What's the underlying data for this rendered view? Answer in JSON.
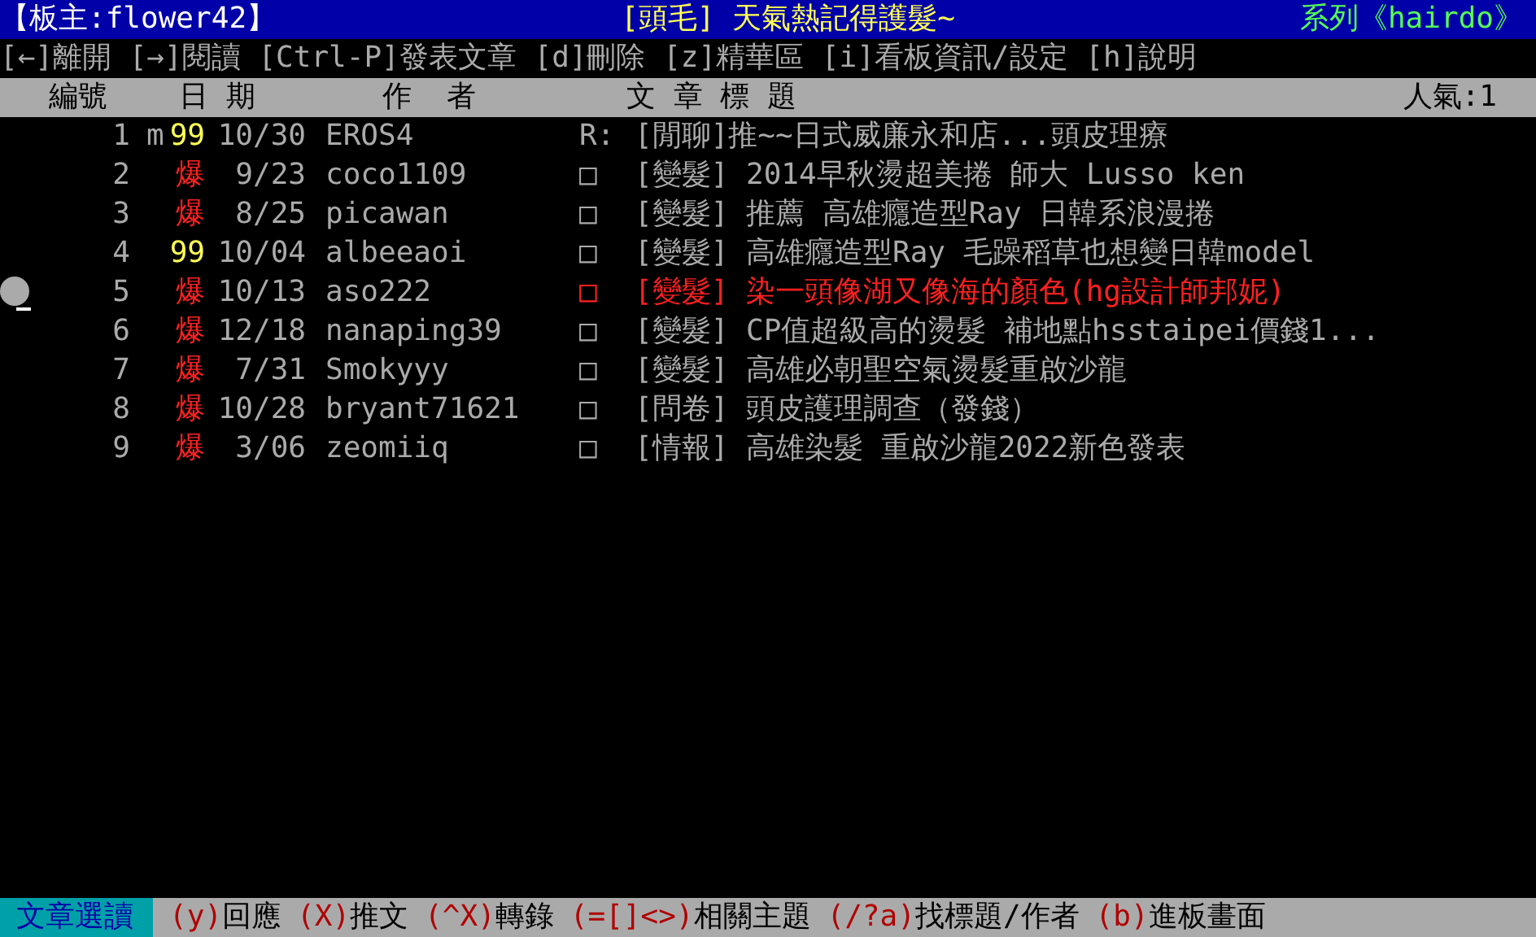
{
  "top_bar": {
    "moderator": "【板主:flower42】",
    "board_title": "[頭毛] 天氣熱記得護髮~",
    "series": "系列《hairdo》"
  },
  "help_bar": "[←]離開 [→]閱讀 [Ctrl-P]發表文章 [d]刪除 [z]精華區 [i]看板資訊/設定 [h]說明",
  "columns": [
    "編號",
    "日 期",
    "作  者",
    "文 章 標 題"
  ],
  "popularity": "人氣:1",
  "rows": [
    {
      "number": "1",
      "flag": "m",
      "recommend": "99",
      "kind": "count",
      "date": "10/30",
      "author": "EROS4",
      "status": "R:",
      "title": "[閒聊]推~~日式威廉永和店...頭皮理療",
      "selected": false
    },
    {
      "number": "2",
      "recommend": "爆",
      "kind": "hot",
      "date": "9/23",
      "author": "coco1109",
      "status": "□",
      "title": "[變髮] 2014早秋燙超美捲 師大 Lusso ken",
      "selected": false
    },
    {
      "number": "3",
      "recommend": "爆",
      "kind": "hot",
      "date": "8/25",
      "author": "picawan",
      "status": "□",
      "title": "[變髮] 推薦 高雄癮造型Ray 日韓系浪漫捲",
      "selected": false
    },
    {
      "number": "4",
      "recommend": "99",
      "kind": "count",
      "date": "10/04",
      "author": "albeeaoi",
      "status": "□",
      "title": "[變髮] 高雄癮造型Ray 毛躁稻草也想變日韓model",
      "selected": false
    },
    {
      "number": "5",
      "recommend": "爆",
      "kind": "hot",
      "date": "10/13",
      "author": "aso222",
      "status": "□",
      "title": "[變髮] 染一頭像湖又像海的顏色(hg設計師邦妮)",
      "selected": true
    },
    {
      "number": "6",
      "recommend": "爆",
      "kind": "hot",
      "date": "12/18",
      "author": "nanaping39",
      "status": "□",
      "title": "[變髮] CP值超級高的燙髮 補地點hsstaipei價錢1...",
      "selected": false
    },
    {
      "number": "7",
      "recommend": "爆",
      "kind": "hot",
      "date": "7/31",
      "author": "Smokyyy",
      "status": "□",
      "title": "[變髮] 高雄必朝聖空氣燙髮重啟沙龍",
      "selected": false
    },
    {
      "number": "8",
      "recommend": "爆",
      "kind": "hot",
      "date": "10/28",
      "author": "bryant71621",
      "status": "□",
      "title": "[問卷] 頭皮護理調查（發錢）",
      "selected": false
    },
    {
      "number": "9",
      "recommend": "爆",
      "kind": "hot",
      "date": "3/06",
      "author": "zeomiiq",
      "status": "□",
      "title": "[情報] 高雄染髮 重啟沙龍2022新色發表",
      "selected": false
    }
  ],
  "status_bar": {
    "mode": "文章選讀",
    "commands": [
      {
        "key": "(y)",
        "label": "回應"
      },
      {
        "key": "(X)",
        "label": "推文"
      },
      {
        "key": "(^X)",
        "label": "轉錄"
      },
      {
        "key": "(=[]<>)",
        "label": "相關主題"
      },
      {
        "key": "(/?a)",
        "label": "找標題/作者"
      },
      {
        "key": "(b)",
        "label": "進板畫面"
      }
    ]
  }
}
